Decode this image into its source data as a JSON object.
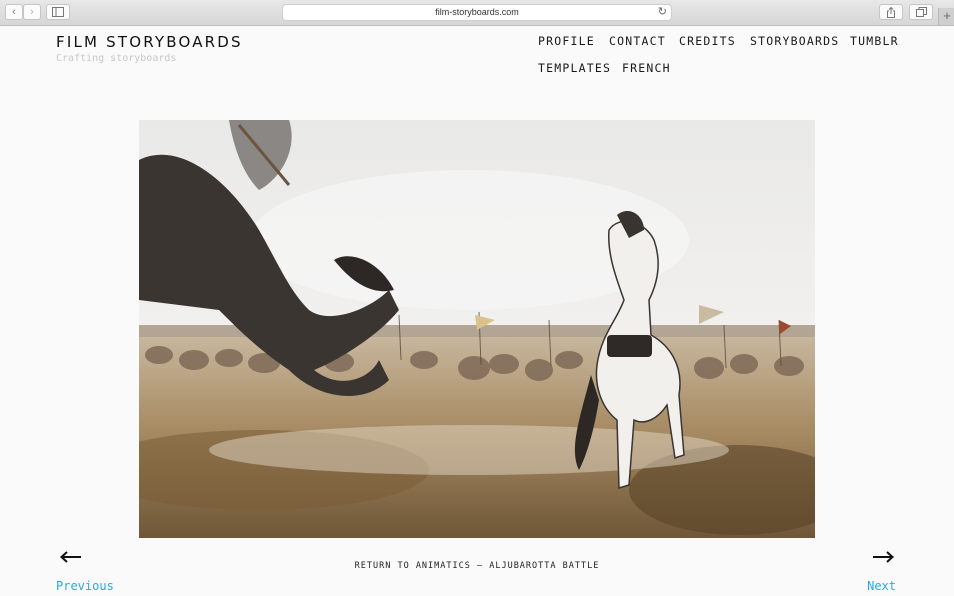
{
  "browser": {
    "url": "film-storyboards.com",
    "back_glyph": "‹",
    "forward_glyph": "›",
    "reload_glyph": "↻",
    "new_tab_glyph": "+"
  },
  "site": {
    "title": "FILM STORYBOARDS",
    "tagline": "Crafting storyboards"
  },
  "nav": {
    "items": [
      "PROFILE",
      "CONTACT",
      "CREDITS",
      "STORYBOARDS",
      "TUMBLR",
      "TEMPLATES",
      "FRENCH"
    ]
  },
  "post": {
    "caption": "RETURN TO ANIMATICS — ALJUBAROTTA BATTLE",
    "previous_label": "Previous",
    "next_label": "Next"
  },
  "colors": {
    "link": "#29a9e0",
    "text": "#1a1a1a",
    "tagline": "#c7c7c7",
    "background": "#fafafa"
  },
  "icons": [
    "back-icon",
    "forward-icon",
    "sidebar-icon",
    "reload-icon",
    "share-icon",
    "tabs-icon",
    "plus-icon",
    "arrow-left-icon",
    "arrow-right-icon"
  ]
}
